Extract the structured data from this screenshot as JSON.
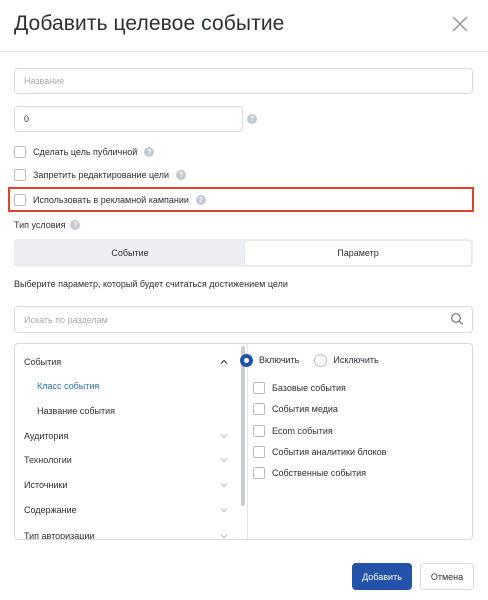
{
  "dialog": {
    "title": "Добавить целевое событие",
    "close_icon": "close-icon"
  },
  "form": {
    "name": {
      "value": "",
      "placeholder": "Название"
    },
    "value": {
      "value": "0",
      "help_icon": "question-icon"
    },
    "checkboxes": [
      {
        "label": "Сделать цель публичной",
        "checked": false
      },
      {
        "label": "Запретить редактирование цели",
        "checked": false
      },
      {
        "label": "Использовать в рекламной кампании",
        "checked": false
      }
    ],
    "condition_type_label": "Тип условия",
    "condition_tabs": [
      {
        "label": "Событие",
        "active": false
      },
      {
        "label": "Параметр",
        "active": true
      }
    ],
    "instruction": "Выберите параметр, который будет считаться достижением цели",
    "search": {
      "value": "",
      "placeholder": "Искать по разделам",
      "icon": "search-icon"
    }
  },
  "tree": {
    "sections": [
      {
        "label": "События",
        "expanded": true
      },
      {
        "label": "Класс события",
        "child": true,
        "active": true
      },
      {
        "label": "Название события",
        "child": true,
        "active": false
      },
      {
        "label": "Аудитория",
        "expanded": false
      },
      {
        "label": "Технологии",
        "expanded": false
      },
      {
        "label": "Источники",
        "expanded": false
      },
      {
        "label": "Содержание",
        "expanded": false
      },
      {
        "label": "Тип авторизации",
        "expanded": false
      }
    ]
  },
  "filter": {
    "mode_options": [
      {
        "label": "Включить",
        "selected": true
      },
      {
        "label": "Исключить",
        "selected": false
      }
    ],
    "options": [
      {
        "label": "Базовые события",
        "checked": false
      },
      {
        "label": "События медиа",
        "checked": false
      },
      {
        "label": "Ecom события",
        "checked": false
      },
      {
        "label": "События аналитики блоков",
        "checked": false
      },
      {
        "label": "Собственные события",
        "checked": false
      }
    ]
  },
  "footer": {
    "submit_label": "Добавить",
    "cancel_label": "Отмена"
  },
  "colors": {
    "primary": "#2452a8",
    "link_active": "#2d6fb7",
    "highlight_border": "#d9442f"
  }
}
